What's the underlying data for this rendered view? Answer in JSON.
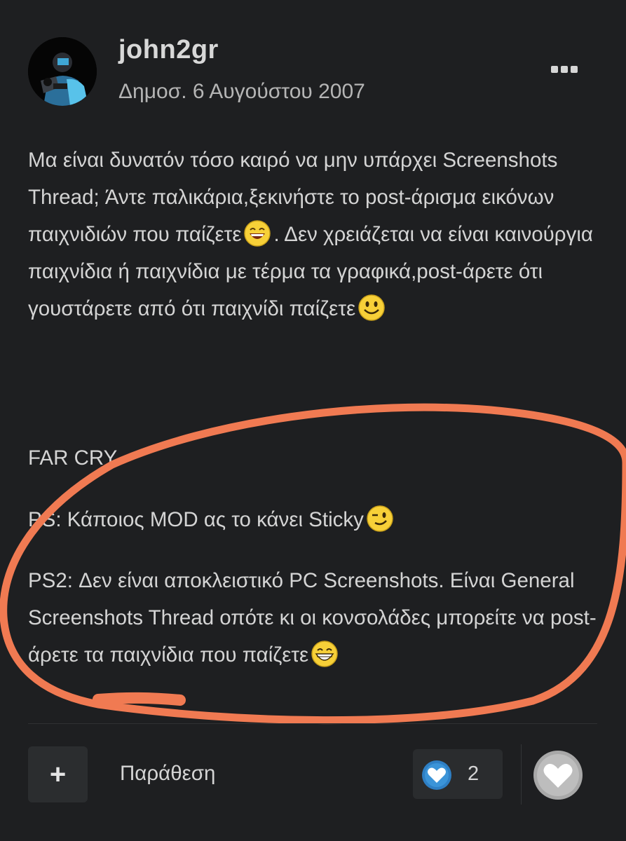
{
  "post": {
    "username": "john2gr",
    "date": "Δημοσ. 6 Αυγούστου 2007",
    "avatar_icon": "avatar-sub-zero",
    "paragraph1_part1": "Μα είναι δυνατόν τόσο καιρό να μην υπάρχει Screenshots Thread; Άντε παλικάρια,ξεκινήστε το post-άρισμα εικόνων παιχνιδιών που παίζετε",
    "paragraph1_part2": ". Δεν χρειάζεται να είναι καινούργια παιχνίδια ή παιχνίδια με τέρμα τα γραφικά,post-άρετε ότι γουστάρετε από ότι παιχνίδι παίζετε",
    "far_cry": "FAR CRY",
    "ps": "PS: Κάποιος MOD ας το κάνει Sticky",
    "ps2": "PS2: Δεν είναι αποκλειστικό PC Screenshots. Είναι General Screenshots Thread οπότε κι οι κονσολάδες μπορείτε να post-άρετε τα παιχνίδια που παίζετε"
  },
  "actions": {
    "add_icon": "+",
    "quote_label": "Παράθεση",
    "reaction_count": "2",
    "reaction_icon": "heart-icon",
    "like_icon": "heart-icon"
  },
  "colors": {
    "background": "#1e1f21",
    "annotation": "#f07a52",
    "reaction_blue": "#2e7fc4"
  }
}
